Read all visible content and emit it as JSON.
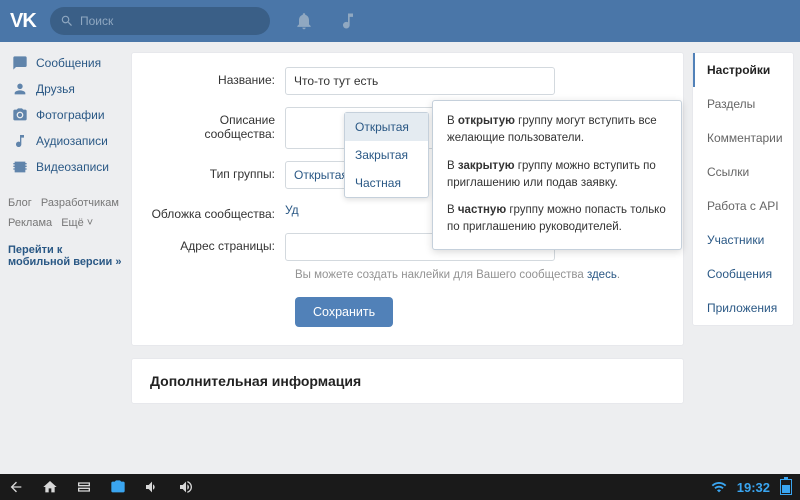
{
  "header": {
    "logo_text": "VK",
    "search_placeholder": "Поиск"
  },
  "left_menu": {
    "items": [
      {
        "label": "Сообщения"
      },
      {
        "label": "Друзья"
      },
      {
        "label": "Фотографии"
      },
      {
        "label": "Аудиозаписи"
      },
      {
        "label": "Видеозаписи"
      }
    ],
    "footer_links": [
      "Блог",
      "Разработчикам",
      "Реклама",
      "Ещё ˅"
    ],
    "mobile_link": "Перейти к мобильной версии »"
  },
  "form": {
    "name_label": "Название:",
    "name_value": "Что-то тут есть",
    "desc_label": "Описание сообщества:",
    "type_label": "Тип группы:",
    "type_selected": "Открытая",
    "type_options": [
      "Открытая",
      "Закрытая",
      "Частная"
    ],
    "cover_label": "Обложка сообщества:",
    "cover_link_prefix": "Уд",
    "addr_label": "Адрес страницы:",
    "addr_value": "",
    "stickers_hint_1": "Вы можете создать наклейки для Вашего сообщества ",
    "stickers_hint_link": "здесь",
    "save_label": "Сохранить"
  },
  "tooltip": {
    "p1_a": "В ",
    "p1_b": "открытую",
    "p1_c": " группу могут вступить все желающие пользователи.",
    "p2_a": "В ",
    "p2_b": "закрытую",
    "p2_c": " группу можно вступить по приглашению или подав заявку.",
    "p3_a": "В ",
    "p3_b": "частную",
    "p3_c": " группу можно попасть только по приглашению руководителей."
  },
  "secondary": {
    "title": "Дополнительная информация"
  },
  "right_tabs": {
    "items": [
      {
        "label": "Настройки",
        "active": true
      },
      {
        "label": "Разделы"
      },
      {
        "label": "Комментарии"
      },
      {
        "label": "Ссылки"
      },
      {
        "label": "Работа с API"
      },
      {
        "label": "Участники",
        "link": true
      },
      {
        "label": "Сообщения",
        "link": true
      },
      {
        "label": "Приложения",
        "link": true
      }
    ]
  },
  "taskbar": {
    "time": "19:32"
  }
}
